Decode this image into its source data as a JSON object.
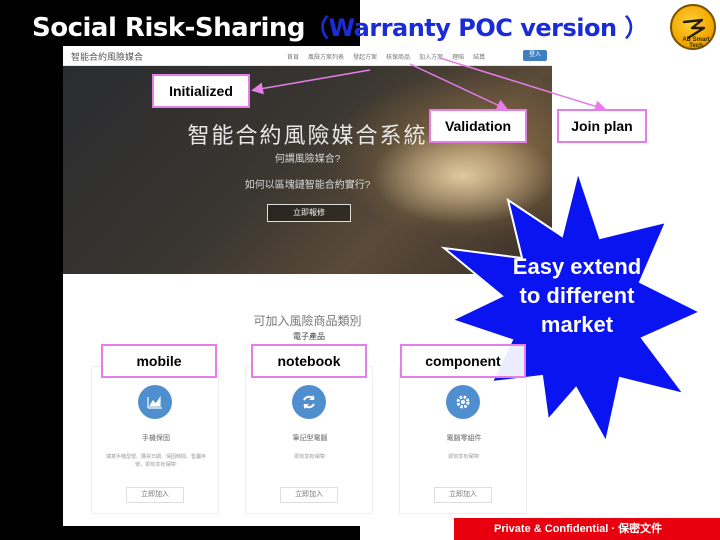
{
  "slide": {
    "title_main": "Social Risk-Sharing",
    "title_paren": "（Warranty POC version ）",
    "logo_text": "AB Smart Tech",
    "footer": "Private & Confidential · 保密文件"
  },
  "website": {
    "brand": "智能合約風險媒合",
    "nav": [
      "首頁",
      "風險方案列表",
      "發起方案",
      "核保商品",
      "加入方案",
      "理賠",
      "結算"
    ],
    "login": "登入",
    "hero_title": "智能合約風險媒合系統",
    "hero_sub1": "何謂風險媒合?",
    "hero_sub2": "如何以區塊鏈智能合約實行?",
    "hero_cta": "立即報修",
    "section_title": "可加入風險商品類別",
    "section_sub": "電子產品",
    "cards": [
      {
        "name": "手機保固",
        "desc": "填寫手機型號、購買日期、保固時間、售屬序號，即刻享有保障!",
        "join": "立即加入",
        "icon": "chart-icon"
      },
      {
        "name": "筆記型電腦",
        "desc": "即刻享有保障!",
        "join": "立即加入",
        "icon": "refresh-icon"
      },
      {
        "name": "電腦零組件",
        "desc": "即刻享有保障!",
        "join": "立即加入",
        "icon": "gear-icon"
      }
    ]
  },
  "callouts": {
    "initialized": "Initialized",
    "validation": "Validation",
    "join_plan": "Join plan",
    "mobile": "mobile",
    "notebook": "notebook",
    "component": "component"
  },
  "burst": {
    "line1": "Easy extend",
    "line2": "to different",
    "line3": "market"
  },
  "colors": {
    "title_paren": "#1a2bd8",
    "callout_border": "#e67ee9",
    "burst_fill": "#0a14f0",
    "footer_bg": "#e8000f",
    "card_icon": "#4f8fcf"
  }
}
